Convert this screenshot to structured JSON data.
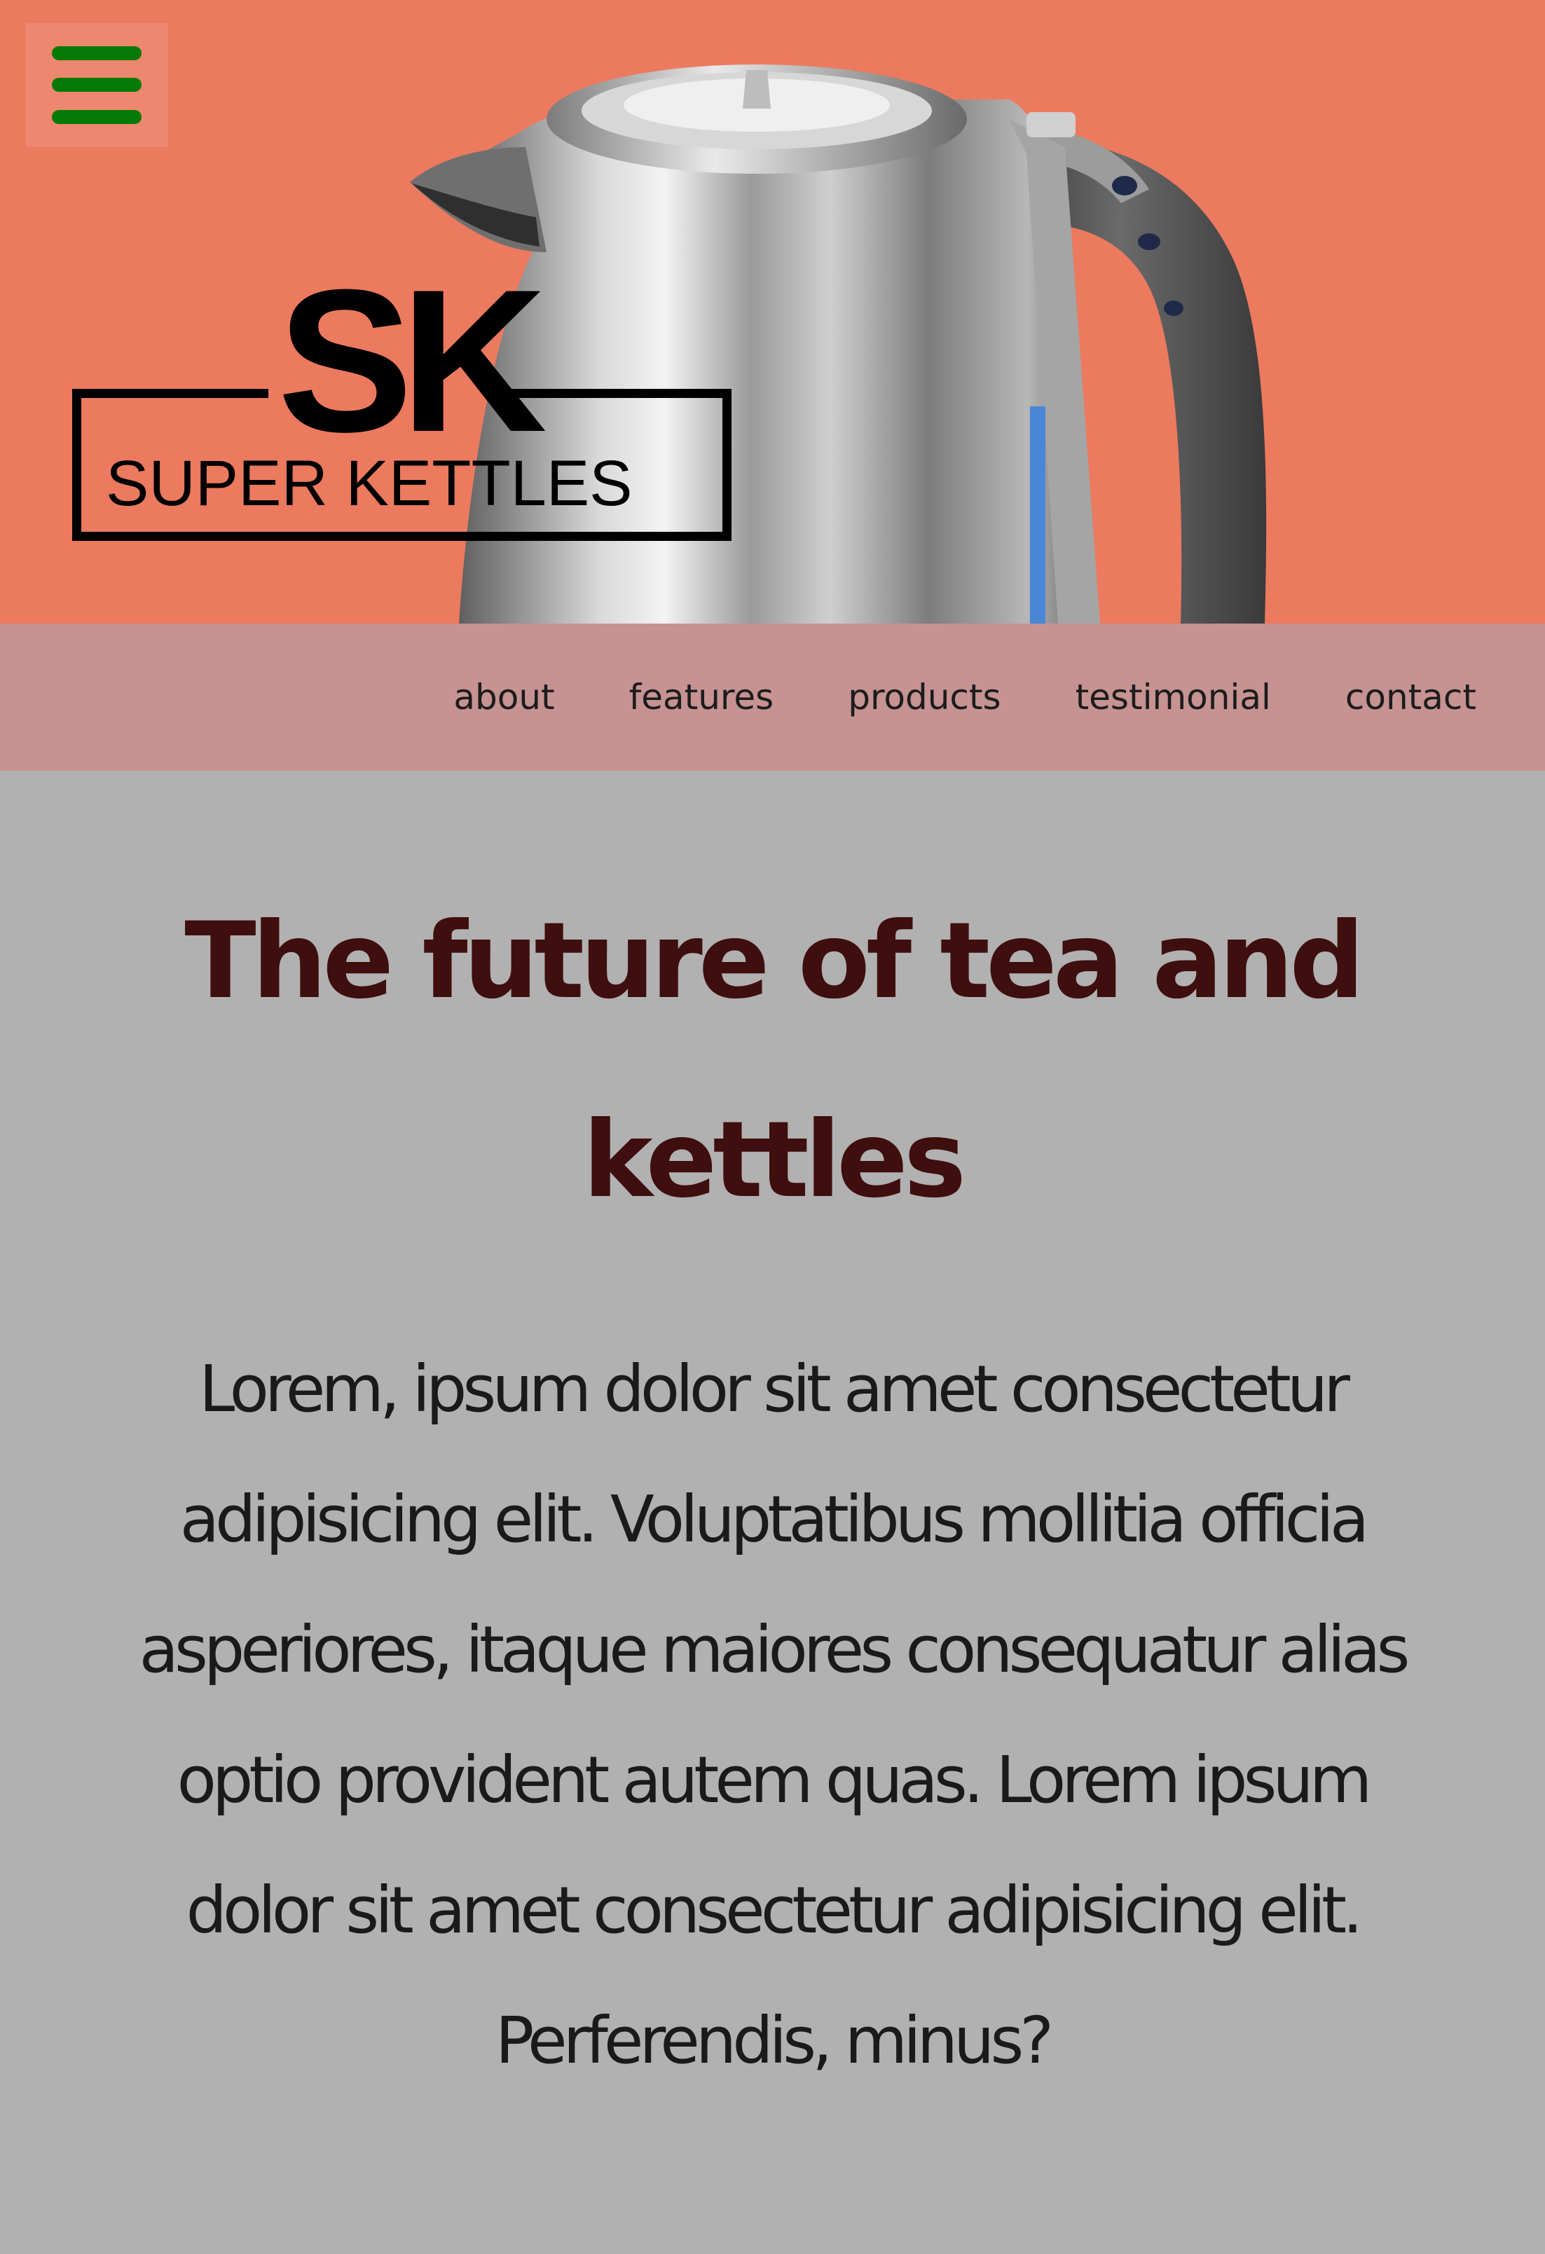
{
  "header": {
    "menu_icon": "hamburger-icon",
    "logo": {
      "mark": "SK",
      "name": "SUPER KETTLES"
    },
    "hero_image": "stainless-steel-electric-kettle"
  },
  "nav": {
    "items": [
      {
        "label": "about"
      },
      {
        "label": "features"
      },
      {
        "label": "products"
      },
      {
        "label": "testimonial"
      },
      {
        "label": "contact"
      }
    ]
  },
  "main": {
    "headline": "The future of tea and kettles",
    "body": "Lorem, ipsum dolor sit amet consectetur adipisicing elit. Voluptatibus mollitia officia asperiores, itaque maiores consequatur alias optio provident autem quas. Lorem ipsum dolor sit amet consectetur adipisicing elit. Perferendis, minus?"
  },
  "colors": {
    "hero_bg": "#ec7a5f",
    "nav_bg": "#c69292",
    "page_bg": "#b1b1b1",
    "headline": "#3f0e0e",
    "menu_icon": "#067a06"
  }
}
